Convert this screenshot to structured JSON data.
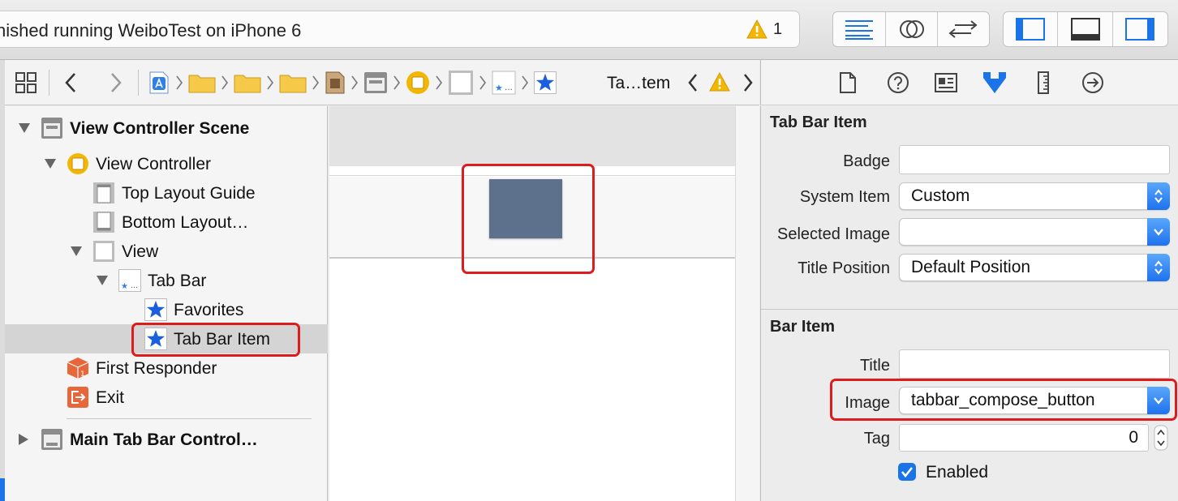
{
  "toolbar": {
    "status_text": "nished running WeiboTest on iPhone 6",
    "warning_count": "1",
    "editor_buttons": [
      "standard-editor-icon",
      "assistant-editor-icon",
      "version-editor-icon"
    ],
    "view_buttons": [
      "navigator-panel-icon",
      "debug-panel-icon",
      "utilities-panel-icon"
    ]
  },
  "jumpbar": {
    "current_item": "Ta…tem"
  },
  "outline": {
    "items": [
      {
        "label": "View Controller Scene",
        "bold": true
      },
      {
        "label": "View Controller"
      },
      {
        "label": "Top Layout Guide"
      },
      {
        "label": "Bottom Layout…"
      },
      {
        "label": "View"
      },
      {
        "label": "Tab Bar"
      },
      {
        "label": "Favorites"
      },
      {
        "label": "Tab Bar Item"
      },
      {
        "label": "First Responder"
      },
      {
        "label": "Exit"
      },
      {
        "label": "Main Tab Bar Control…",
        "bold": true
      }
    ]
  },
  "inspector": {
    "tabs": [
      "file-inspector-icon",
      "quick-help-icon",
      "identity-inspector-icon",
      "attributes-inspector-icon",
      "size-inspector-icon",
      "connections-inspector-icon"
    ],
    "tab_bar_item": {
      "title": "Tab Bar Item",
      "badge_label": "Badge",
      "badge_value": "",
      "system_item_label": "System Item",
      "system_item_value": "Custom",
      "selected_image_label": "Selected Image",
      "selected_image_value": "",
      "title_position_label": "Title Position",
      "title_position_value": "Default Position"
    },
    "bar_item": {
      "title": "Bar Item",
      "title_label": "Title",
      "title_value": "",
      "image_label": "Image",
      "image_value": "tabbar_compose_button",
      "tag_label": "Tag",
      "tag_value": "0",
      "enabled_label": "Enabled",
      "enabled": true
    }
  },
  "colors": {
    "accent": "#1a73e8",
    "highlight_red": "#dd1c1c",
    "tab_icon_fill": "#5e718c",
    "warning": "#f2b705"
  }
}
